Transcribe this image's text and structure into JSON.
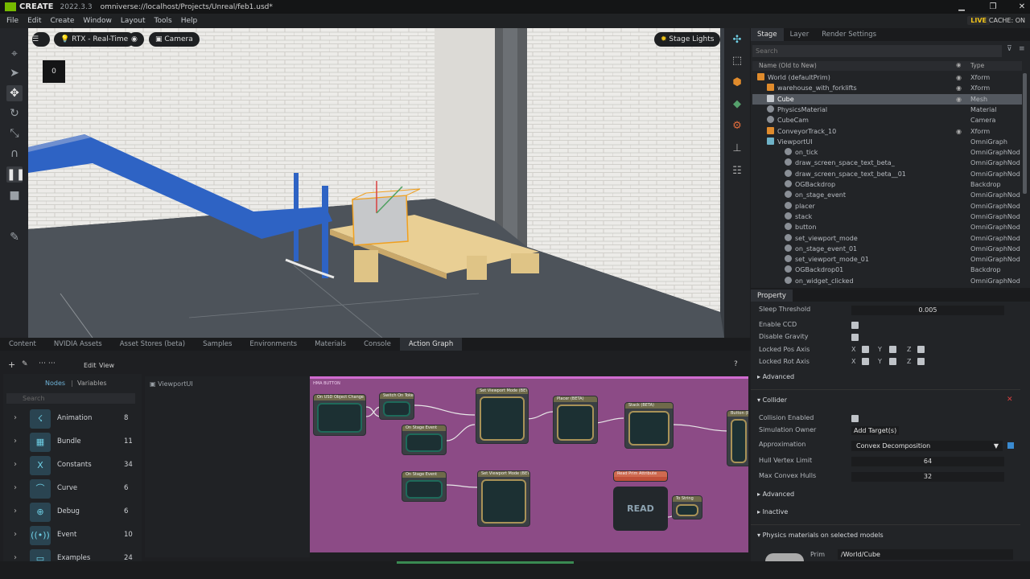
{
  "titlebar": {
    "app": "CREATE",
    "version": "2022.3.3",
    "path": "omniverse://localhost/Projects/Unreal/feb1.usd*"
  },
  "menu": [
    "File",
    "Edit",
    "Create",
    "Window",
    "Layout",
    "Tools",
    "Help"
  ],
  "status": {
    "live": "LIVE",
    "cache": "CACHE: ON"
  },
  "viewport": {
    "render_mode": "RTX - Real-Time",
    "camera": "Camera",
    "lights": "Stage Lights",
    "frame_counter": "0"
  },
  "stage": {
    "tabs": [
      "Stage",
      "Layer",
      "Render Settings"
    ],
    "search_placeholder": "Search",
    "col_name": "Name (Old to New)",
    "col_type": "Type",
    "rows": [
      {
        "name": "World (defaultPrim)",
        "type": "Xform"
      },
      {
        "name": "warehouse_with_forklifts",
        "type": "Xform"
      },
      {
        "name": "Cube",
        "type": "Mesh"
      },
      {
        "name": "PhysicsMaterial",
        "type": "Material"
      },
      {
        "name": "CubeCam",
        "type": "Camera"
      },
      {
        "name": "ConveyorTrack_10",
        "type": "Xform"
      },
      {
        "name": "ViewportUI",
        "type": "OmniGraph"
      },
      {
        "name": "on_tick",
        "type": "OmniGraphNod"
      },
      {
        "name": "draw_screen_space_text_beta_",
        "type": "OmniGraphNod"
      },
      {
        "name": "draw_screen_space_text_beta__01",
        "type": "OmniGraphNod"
      },
      {
        "name": "OGBackdrop",
        "type": "Backdrop"
      },
      {
        "name": "on_stage_event",
        "type": "OmniGraphNod"
      },
      {
        "name": "placer",
        "type": "OmniGraphNod"
      },
      {
        "name": "stack",
        "type": "OmniGraphNod"
      },
      {
        "name": "button",
        "type": "OmniGraphNod"
      },
      {
        "name": "set_viewport_mode",
        "type": "OmniGraphNod"
      },
      {
        "name": "on_stage_event_01",
        "type": "OmniGraphNod"
      },
      {
        "name": "set_viewport_mode_01",
        "type": "OmniGraphNod"
      },
      {
        "name": "OGBackdrop01",
        "type": "Backdrop"
      },
      {
        "name": "on_widget_clicked",
        "type": "OmniGraphNod"
      }
    ]
  },
  "property": {
    "tab": "Property",
    "sleep_threshold_label": "Sleep Threshold",
    "sleep_threshold_value": "0.005",
    "enable_ccd": "Enable CCD",
    "disable_gravity": "Disable Gravity",
    "locked_pos": "Locked Pos Axis",
    "locked_rot": "Locked Rot Axis",
    "axis_x": "X",
    "axis_y": "Y",
    "axis_z": "Z",
    "advanced": "Advanced",
    "collider": "Collider",
    "collision_enabled": "Collision Enabled",
    "tooltip": "Add Target(s)",
    "simulation_owner": "Simulation Owner",
    "approximation": "Approximation",
    "approximation_value": "Convex Decomposition",
    "hull_vertex_limit": "Hull Vertex Limit",
    "hull_vertex_value": "64",
    "max_convex_hulls": "Max Convex Hulls",
    "max_convex_value": "32",
    "advanced2": "Advanced",
    "inactive": "Inactive",
    "physics_materials": "Physics materials on selected models",
    "prim_label": "Prim",
    "prim_value": "/World/Cube"
  },
  "bottom": {
    "tabs": [
      "Content",
      "NVIDIA Assets",
      "Asset Stores (beta)",
      "Samples",
      "Environments",
      "Materials",
      "Console",
      "Action Graph"
    ],
    "edit": "Edit",
    "view": "View",
    "nodes_tab": "Nodes",
    "variables_tab": "Variables",
    "search_placeholder": "Search",
    "categories": [
      {
        "label": "Animation",
        "count": "8"
      },
      {
        "label": "Bundle",
        "count": "11"
      },
      {
        "label": "Constants",
        "count": "34"
      },
      {
        "label": "Curve",
        "count": "6"
      },
      {
        "label": "Debug",
        "count": "6"
      },
      {
        "label": "Event",
        "count": "10"
      },
      {
        "label": "Examples",
        "count": "24"
      }
    ],
    "graph_name": "ViewportUI",
    "graph_backdrop": "HMA BUTTON",
    "help": "?",
    "nodes": [
      {
        "title": "On USD Object Change"
      },
      {
        "title": "Switch On Token"
      },
      {
        "title": "On Stage Event"
      },
      {
        "title": "Set Viewport Mode (BETA)"
      },
      {
        "title": "Placer (BETA)"
      },
      {
        "title": "Stack (BETA)"
      },
      {
        "title": "Button (BETA)"
      },
      {
        "title": "On Stage Event"
      },
      {
        "title": "Set Viewport Mode (BETA)"
      },
      {
        "title": "Read Prim Attribute"
      },
      {
        "title": "To String"
      }
    ],
    "read_label": "READ"
  }
}
